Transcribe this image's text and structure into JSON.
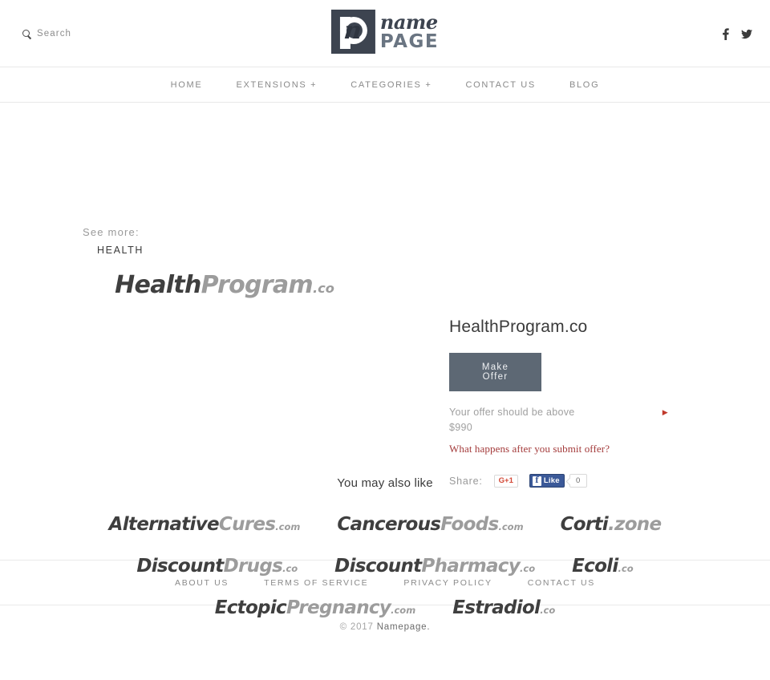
{
  "header": {
    "search": {
      "label": "Search",
      "icon": "search-icon"
    },
    "logo": {
      "mark_letter": "p",
      "script_letter": "n",
      "word_top": "name",
      "word_bottom": "PAGE"
    },
    "social": [
      {
        "name": "facebook-icon",
        "label": "f"
      },
      {
        "name": "twitter-icon",
        "label": "t"
      }
    ]
  },
  "nav": {
    "items": [
      {
        "label": "HOME"
      },
      {
        "label": "EXTENSIONS +"
      },
      {
        "label": "CATEGORIES +"
      },
      {
        "label": "CONTACT US"
      },
      {
        "label": "BLOG"
      }
    ]
  },
  "see_more": {
    "label": "See more:",
    "category": "HEALTH"
  },
  "hero": {
    "mark": {
      "dark": "Health",
      "light": "Program",
      "tld": ".co"
    }
  },
  "panel": {
    "title": "HealthProgram.co",
    "offer_button": "Make Offer",
    "offer_note": "Your offer should be above $990",
    "offer_note_line1": "Your offer should be above",
    "offer_note_line2": "$990",
    "offer_arrow": "▶",
    "offer_link": "What happens after you submit offer?",
    "share_label": "Share:",
    "gplus_label": "G+1",
    "fb_f": "f",
    "fb_like_label": "Like",
    "fb_count": "0"
  },
  "related": {
    "title": "You may also like",
    "rows": [
      [
        {
          "dark": "Alternative",
          "light": "Cures",
          "tld": ".com",
          "tld_full": false
        },
        {
          "dark": "Cancerous",
          "light": "Foods",
          "tld": ".com",
          "tld_full": false
        },
        {
          "dark": "Corti",
          "light": "",
          "tld": ".zone",
          "tld_full": true
        }
      ],
      [
        {
          "dark": "Discount",
          "light": "Drugs",
          "tld": ".co",
          "tld_full": false
        },
        {
          "dark": "Discount",
          "light": "Pharmacy",
          "tld": ".co",
          "tld_full": false
        },
        {
          "dark": "Ecoli",
          "light": "",
          "tld": ".co",
          "tld_full": false
        }
      ],
      [
        {
          "dark": "Ectopic",
          "light": "Pregnancy",
          "tld": ".com",
          "tld_full": false
        },
        {
          "dark": "Estradiol",
          "light": "",
          "tld": ".co",
          "tld_full": false
        }
      ]
    ]
  },
  "footer": {
    "links": [
      {
        "label": "ABOUT US"
      },
      {
        "label": "TERMS OF SERVICE"
      },
      {
        "label": "PRIVACY POLICY"
      },
      {
        "label": "CONTACT US"
      }
    ],
    "copyright_prefix": "© 2017",
    "brand": "Namepage."
  },
  "colors": {
    "accent_button": "#5d6874",
    "logo_dark": "#3d4450",
    "logo_light": "#6a7582",
    "link_red": "#a33a3a",
    "facebook_blue": "#3b5998",
    "gplus_red": "#d34836"
  }
}
